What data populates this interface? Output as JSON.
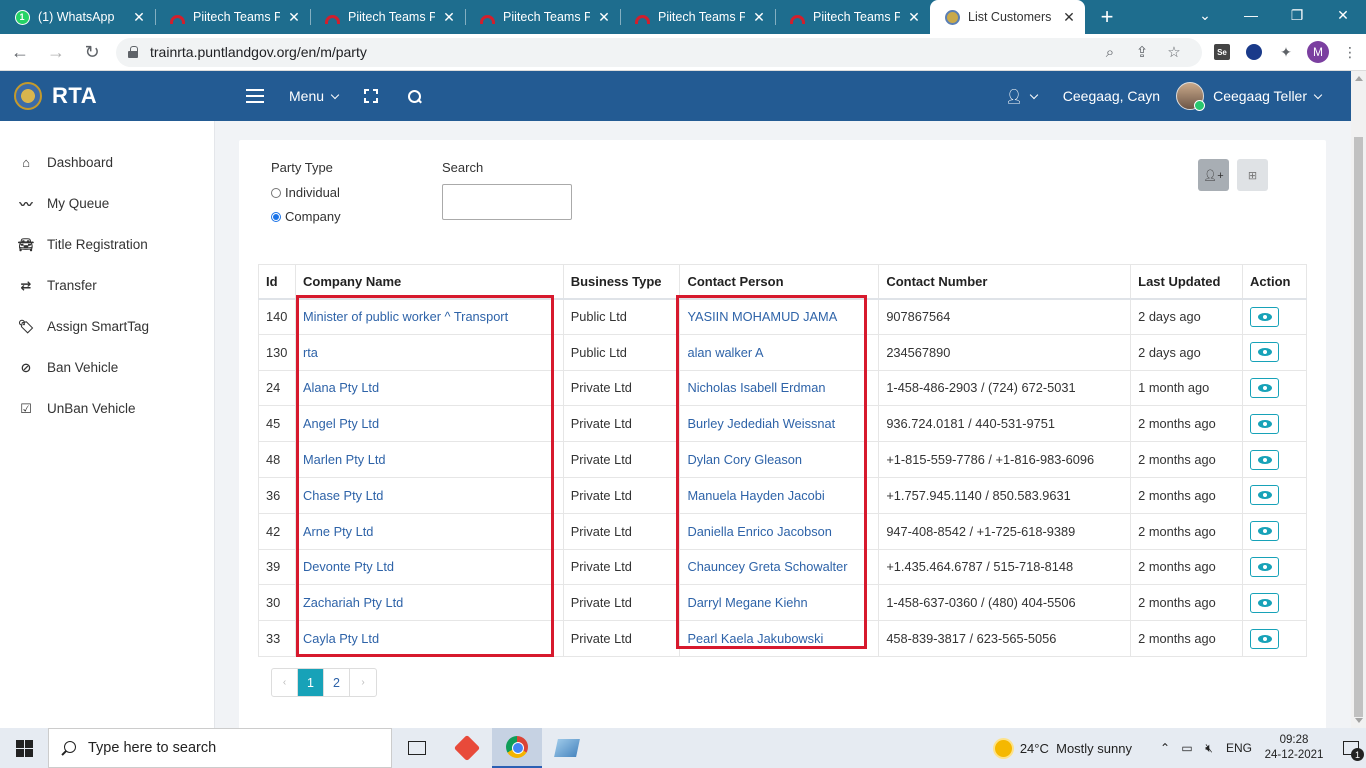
{
  "browser": {
    "tabs": [
      {
        "title": "(1) WhatsApp",
        "icon": "whatsapp-icon",
        "active": false
      },
      {
        "title": "Piitech Teams Po",
        "icon": "piitech-icon",
        "active": false
      },
      {
        "title": "Piitech Teams Po",
        "icon": "piitech-icon",
        "active": false
      },
      {
        "title": "Piitech Teams Po",
        "icon": "piitech-icon",
        "active": false
      },
      {
        "title": "Piitech Teams Po",
        "icon": "piitech-icon",
        "active": false
      },
      {
        "title": "Piitech Teams Po",
        "icon": "piitech-icon",
        "active": false
      },
      {
        "title": "List Customers | T",
        "icon": "rta-crest-icon",
        "active": true
      }
    ],
    "url": "trainrta.puntlandgov.org/en/m/party",
    "profile_initial": "M",
    "extension_label": "Se"
  },
  "app": {
    "brand": "RTA",
    "menu_label": "Menu",
    "user_name": "Ceegaag, Cayn",
    "user_role": "Ceegaag Teller"
  },
  "sidebar": {
    "items": [
      {
        "label": "Dashboard",
        "icon": "home-icon"
      },
      {
        "label": "My Queue",
        "icon": "trend-icon"
      },
      {
        "label": "Title Registration",
        "icon": "car-icon"
      },
      {
        "label": "Transfer",
        "icon": "transfer-icon"
      },
      {
        "label": "Assign SmartTag",
        "icon": "tag-icon"
      },
      {
        "label": "Ban Vehicle",
        "icon": "ban-icon"
      },
      {
        "label": "UnBan Vehicle",
        "icon": "check-square-icon"
      }
    ]
  },
  "filters": {
    "party_type_label": "Party Type",
    "options": [
      "Individual",
      "Company"
    ],
    "selected": "Company",
    "search_label": "Search",
    "search_value": ""
  },
  "table": {
    "headers": [
      "Id",
      "Company Name",
      "Business Type",
      "Contact Person",
      "Contact Number",
      "Last Updated",
      "Action"
    ],
    "rows": [
      {
        "id": "140",
        "company": "Minister of public worker ^ Transport",
        "business_type": "Public Ltd",
        "contact": "YASIIN MOHAMUD JAMA",
        "number": "907867564",
        "updated": "2 days ago"
      },
      {
        "id": "130",
        "company": "rta",
        "business_type": "Public Ltd",
        "contact": "alan walker A",
        "number": "234567890",
        "updated": "2 days ago"
      },
      {
        "id": "24",
        "company": "Alana Pty Ltd",
        "business_type": "Private Ltd",
        "contact": "Nicholas Isabell Erdman",
        "number": "1-458-486-2903 / (724) 672-5031",
        "updated": "1 month ago"
      },
      {
        "id": "45",
        "company": "Angel Pty Ltd",
        "business_type": "Private Ltd",
        "contact": "Burley Jedediah Weissnat",
        "number": "936.724.0181 / 440-531-9751",
        "updated": "2 months ago"
      },
      {
        "id": "48",
        "company": "Marlen Pty Ltd",
        "business_type": "Private Ltd",
        "contact": "Dylan Cory Gleason",
        "number": "+1-815-559-7786 / +1-816-983-6096",
        "updated": "2 months ago"
      },
      {
        "id": "36",
        "company": "Chase Pty Ltd",
        "business_type": "Private Ltd",
        "contact": "Manuela Hayden Jacobi",
        "number": "+1.757.945.1140 / 850.583.9631",
        "updated": "2 months ago"
      },
      {
        "id": "42",
        "company": "Arne Pty Ltd",
        "business_type": "Private Ltd",
        "contact": "Daniella Enrico Jacobson",
        "number": "947-408-8542 / +1-725-618-9389",
        "updated": "2 months ago"
      },
      {
        "id": "39",
        "company": "Devonte Pty Ltd",
        "business_type": "Private Ltd",
        "contact": "Chauncey Greta Schowalter",
        "number": "+1.435.464.6787 / 515-718-8148",
        "updated": "2 months ago"
      },
      {
        "id": "30",
        "company": "Zachariah Pty Ltd",
        "business_type": "Private Ltd",
        "contact": "Darryl Megane Kiehn",
        "number": "1-458-637-0360 / (480) 404-5506",
        "updated": "2 months ago"
      },
      {
        "id": "33",
        "company": "Cayla Pty Ltd",
        "business_type": "Private Ltd",
        "contact": "Pearl Kaela Jakubowski",
        "number": "458-839-3817 / 623-565-5056",
        "updated": "2 months ago"
      }
    ]
  },
  "pagination": {
    "prev": "‹",
    "pages": [
      "1",
      "2"
    ],
    "current": "1",
    "next": "›"
  },
  "taskbar": {
    "search_placeholder": "Type here to search",
    "weather_temp": "24°C",
    "weather_text": "Mostly sunny",
    "language": "ENG",
    "time": "09:28",
    "date": "24-12-2021",
    "notification_count": "1"
  },
  "colors": {
    "header_bg": "#235b93",
    "tabbar_bg": "#1e6d8e",
    "link": "#2e63a8",
    "action_teal": "#17a2b8",
    "highlight_red": "#d7192d"
  }
}
